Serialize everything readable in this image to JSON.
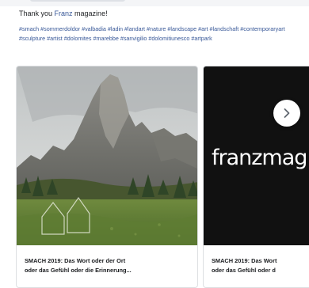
{
  "post": {
    "message_prefix": "Thank you ",
    "message_link": "Franz",
    "message_suffix": " magazine!",
    "hashtags": "#smach #sommerdoldor #valbadia #ladin #landart #nature #landscape #art #landschaft #contemporaryart #sculpture #artist #dolomites #marebbe #sanvigilio #dolomitiunesco #artpark"
  },
  "carousel": {
    "cards": [
      {
        "caption_line1": "SMACH 2019: Das Wort oder der Ort",
        "caption_line2": "oder das Gefühl oder die Erinnerung..."
      },
      {
        "brand": "franzmag",
        "caption_line1": "SMACH 2019: Das Wort",
        "caption_line2": "oder das Gefühl oder d"
      }
    ],
    "next_icon": "chevron-right-icon"
  },
  "colors": {
    "link": "#385898",
    "border": "#dddfe2",
    "brand_bg": "#111111"
  }
}
